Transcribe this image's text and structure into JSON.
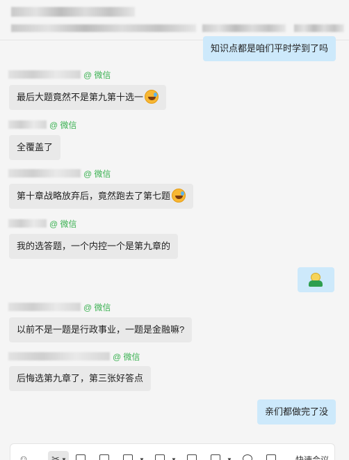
{
  "messages": {
    "m1": {
      "text": "知识点都是咱们平时学到了吗"
    },
    "m2": {
      "source": "@ 微信",
      "text": "最后大题竟然不是第九第十选一"
    },
    "m3": {
      "source": "@ 微信",
      "text": "全覆盖了"
    },
    "m4": {
      "source": "@ 微信",
      "text": "第十章战略放弃后，竟然跑去了第七题"
    },
    "m5": {
      "source": "@ 微信",
      "text": "我的选答题，一个内控一个是第九章的"
    },
    "m6": {
      "source": "@ 微信",
      "text": "以前不是一题是行政事业，一题是金融嘛?"
    },
    "m7": {
      "source": "@ 微信",
      "text": "后悔选第九章了，第三张好答点"
    },
    "m8": {
      "text": "亲们都做完了没"
    }
  },
  "toolbar": {
    "emoji_icon": "☺",
    "scissors_icon": "✂",
    "meeting_label": "快速会议"
  },
  "colors": {
    "outgoing_bubble": "#cde9fb",
    "incoming_bubble": "#e9e9e9",
    "wechat_source": "#3bb152"
  }
}
